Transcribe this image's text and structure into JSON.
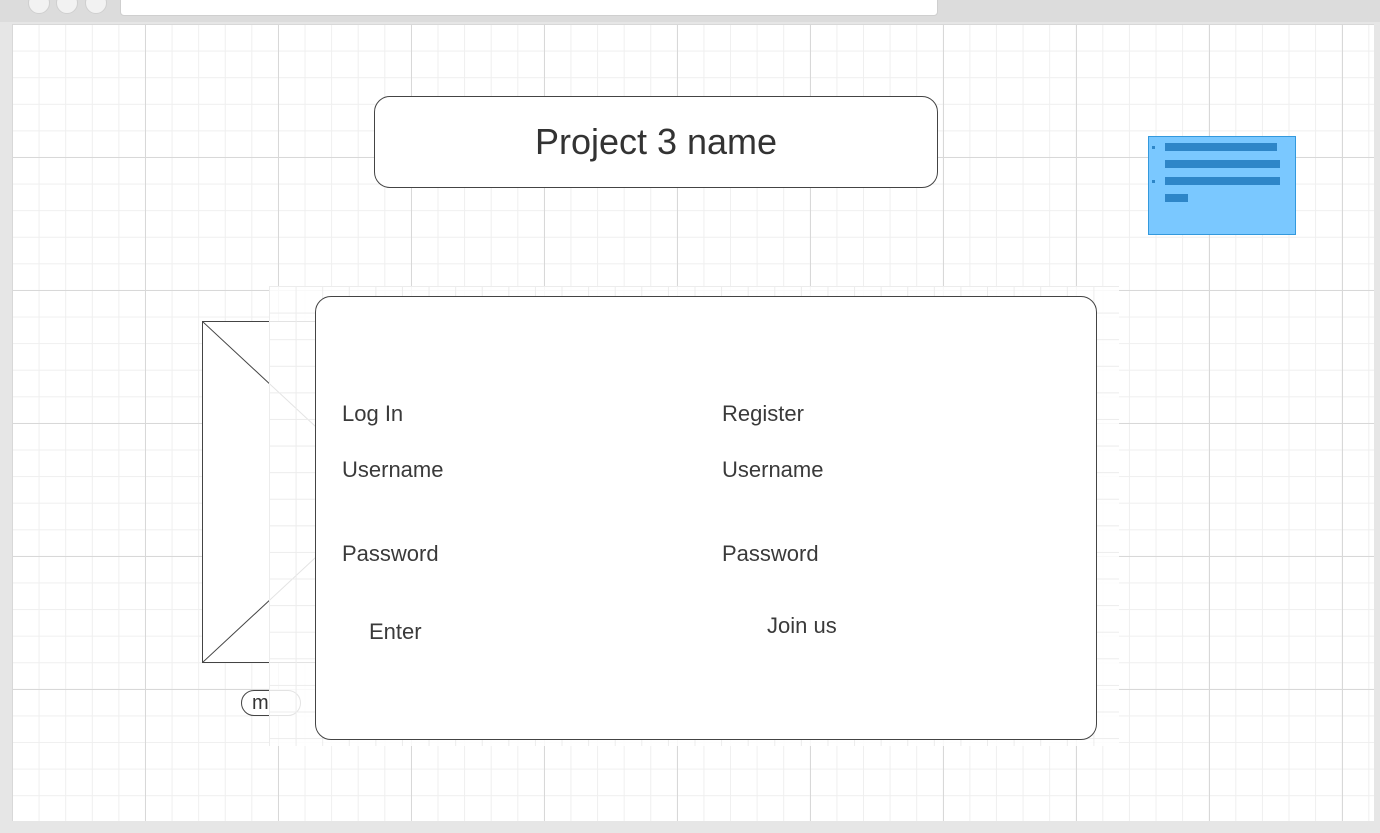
{
  "window": {
    "traffic_lights": [
      "close",
      "minimize",
      "maximize"
    ],
    "address_bar": ""
  },
  "header": {
    "title": "Project 3 name"
  },
  "note_widget": {
    "icon": "text-note-icon",
    "color": "#7ac8ff"
  },
  "image_placeholder": {
    "icon": "image-placeholder-icon",
    "caption_stub": "m"
  },
  "login": {
    "heading": "Log In",
    "username_label": "Username",
    "password_label": "Password",
    "submit_label": "Enter"
  },
  "register": {
    "heading": "Register",
    "username_label": "Username",
    "password_label": "Password",
    "submit_label": "Join us"
  },
  "colors": {
    "canvas_bg": "#ffffff",
    "chrome_bg": "#e6e6e6",
    "stroke": "#444444",
    "note_fill": "#7ac8ff",
    "note_lines": "#2e86c8"
  }
}
